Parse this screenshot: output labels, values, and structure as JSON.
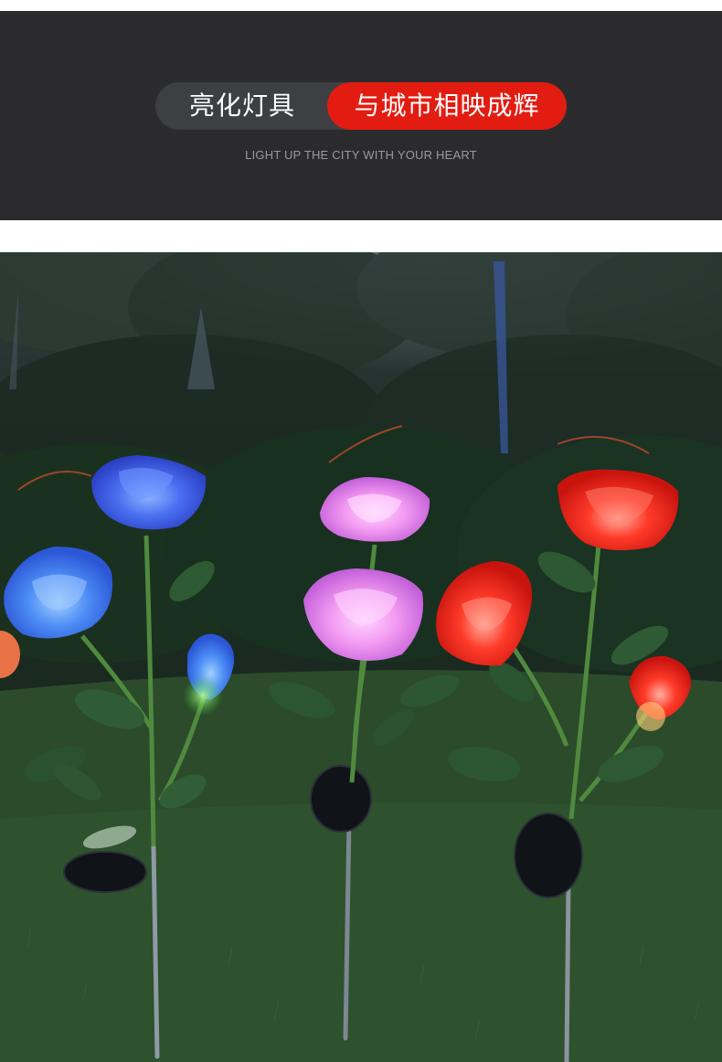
{
  "banner": {
    "tag_left": "亮化灯具",
    "tag_right": "与城市相映成辉",
    "subtitle": "LIGHT UP THE CITY WITH YOUR HEART"
  },
  "colors": {
    "banner_bg": "#2b2b2e",
    "pill_bg": "#3e3f43",
    "accent_red": "#e31c12",
    "subtitle_gray": "#9a9a9e"
  },
  "photo": {
    "subject": "solar rose garden stake lights",
    "rose_colors": [
      "#3f63e8",
      "#e08be8",
      "#ff2a22"
    ]
  }
}
